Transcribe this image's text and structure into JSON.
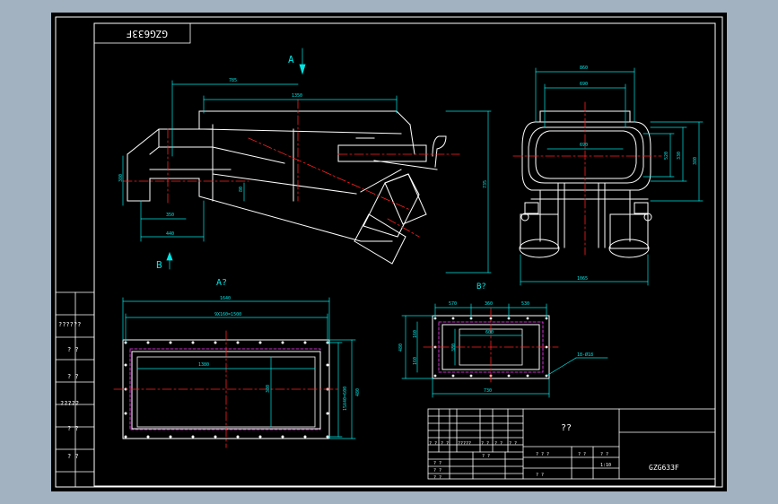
{
  "drawing": {
    "code_box": "GZG633F",
    "view_labels": {
      "a": "A",
      "b": "B",
      "a_view": "A?",
      "b_view": "B?"
    },
    "side_dims": {
      "d1": "785",
      "d2": "1350",
      "d3": "380",
      "d4": "350",
      "d5": "440",
      "d6": "735",
      "d7": "80"
    },
    "front_dims": {
      "d1": "860",
      "d2": "690",
      "d3": "690",
      "d4": "520",
      "d5": "330",
      "d6": "380",
      "d7": "1065"
    },
    "a_view_dims": {
      "d1": "1640",
      "d2": "9X160=1500",
      "d3": "1380",
      "d4": "380",
      "d5": "15X40=600",
      "d6": "480"
    },
    "b_view_dims": {
      "d1": "570",
      "d2": "360",
      "d3": "530",
      "d4": "600",
      "d5": "480",
      "d6": "160",
      "d7": "160",
      "d8": "380",
      "d9": "730",
      "note": "18-Ø18"
    },
    "left_margin": [
      "??????",
      "? ?",
      "? ?",
      "?????",
      "? ?",
      "? ?"
    ]
  },
  "title_block": {
    "name": "??",
    "left_row": [
      "? ?",
      "? ?",
      "?????",
      "? ?",
      "? ?",
      "? ?"
    ],
    "sign1": "? ?",
    "sign2": "? ?",
    "sign3": "? ?",
    "sign4": "? ?",
    "stage_row": [
      "? ? ?",
      "? ?",
      "? ?"
    ],
    "scale": "1:10",
    "scale_label": "? ?",
    "part_no": "GZG633F"
  }
}
